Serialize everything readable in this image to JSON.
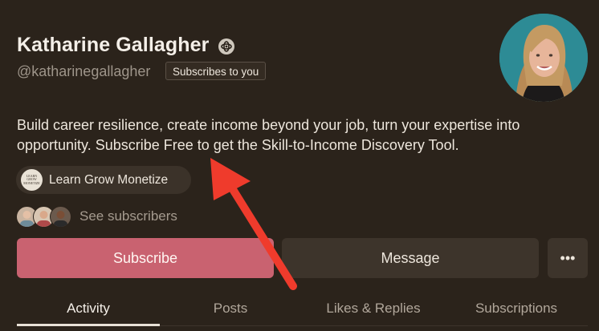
{
  "profile": {
    "name": "Katharine Gallagher",
    "handle": "@katharinegallagher",
    "subscribes_badge": "Subscribes to you",
    "bio": "Build career resilience, create income beyond your job, turn your expertise into opportunity. Subscribe Free to get the Skill-to-Income Discovery Tool.",
    "publication_name": "Learn Grow Monetize",
    "publication_logo_text": [
      "LEARN",
      "GROW",
      "MONETIZE"
    ],
    "see_subscribers": "See subscribers"
  },
  "actions": {
    "subscribe_label": "Subscribe",
    "message_label": "Message",
    "more_label": "•••"
  },
  "tabs": [
    {
      "label": "Activity",
      "active": true
    },
    {
      "label": "Posts",
      "active": false
    },
    {
      "label": "Likes & Replies",
      "active": false
    },
    {
      "label": "Subscriptions",
      "active": false
    }
  ],
  "icons": {
    "verified": "substack-badge-icon",
    "annotation": "red-arrow-annotation"
  },
  "colors": {
    "background": "#2b231b",
    "subscribe_button": "#c96270",
    "secondary_button": "#3d342b",
    "annotation_arrow": "#ef3b2c"
  }
}
